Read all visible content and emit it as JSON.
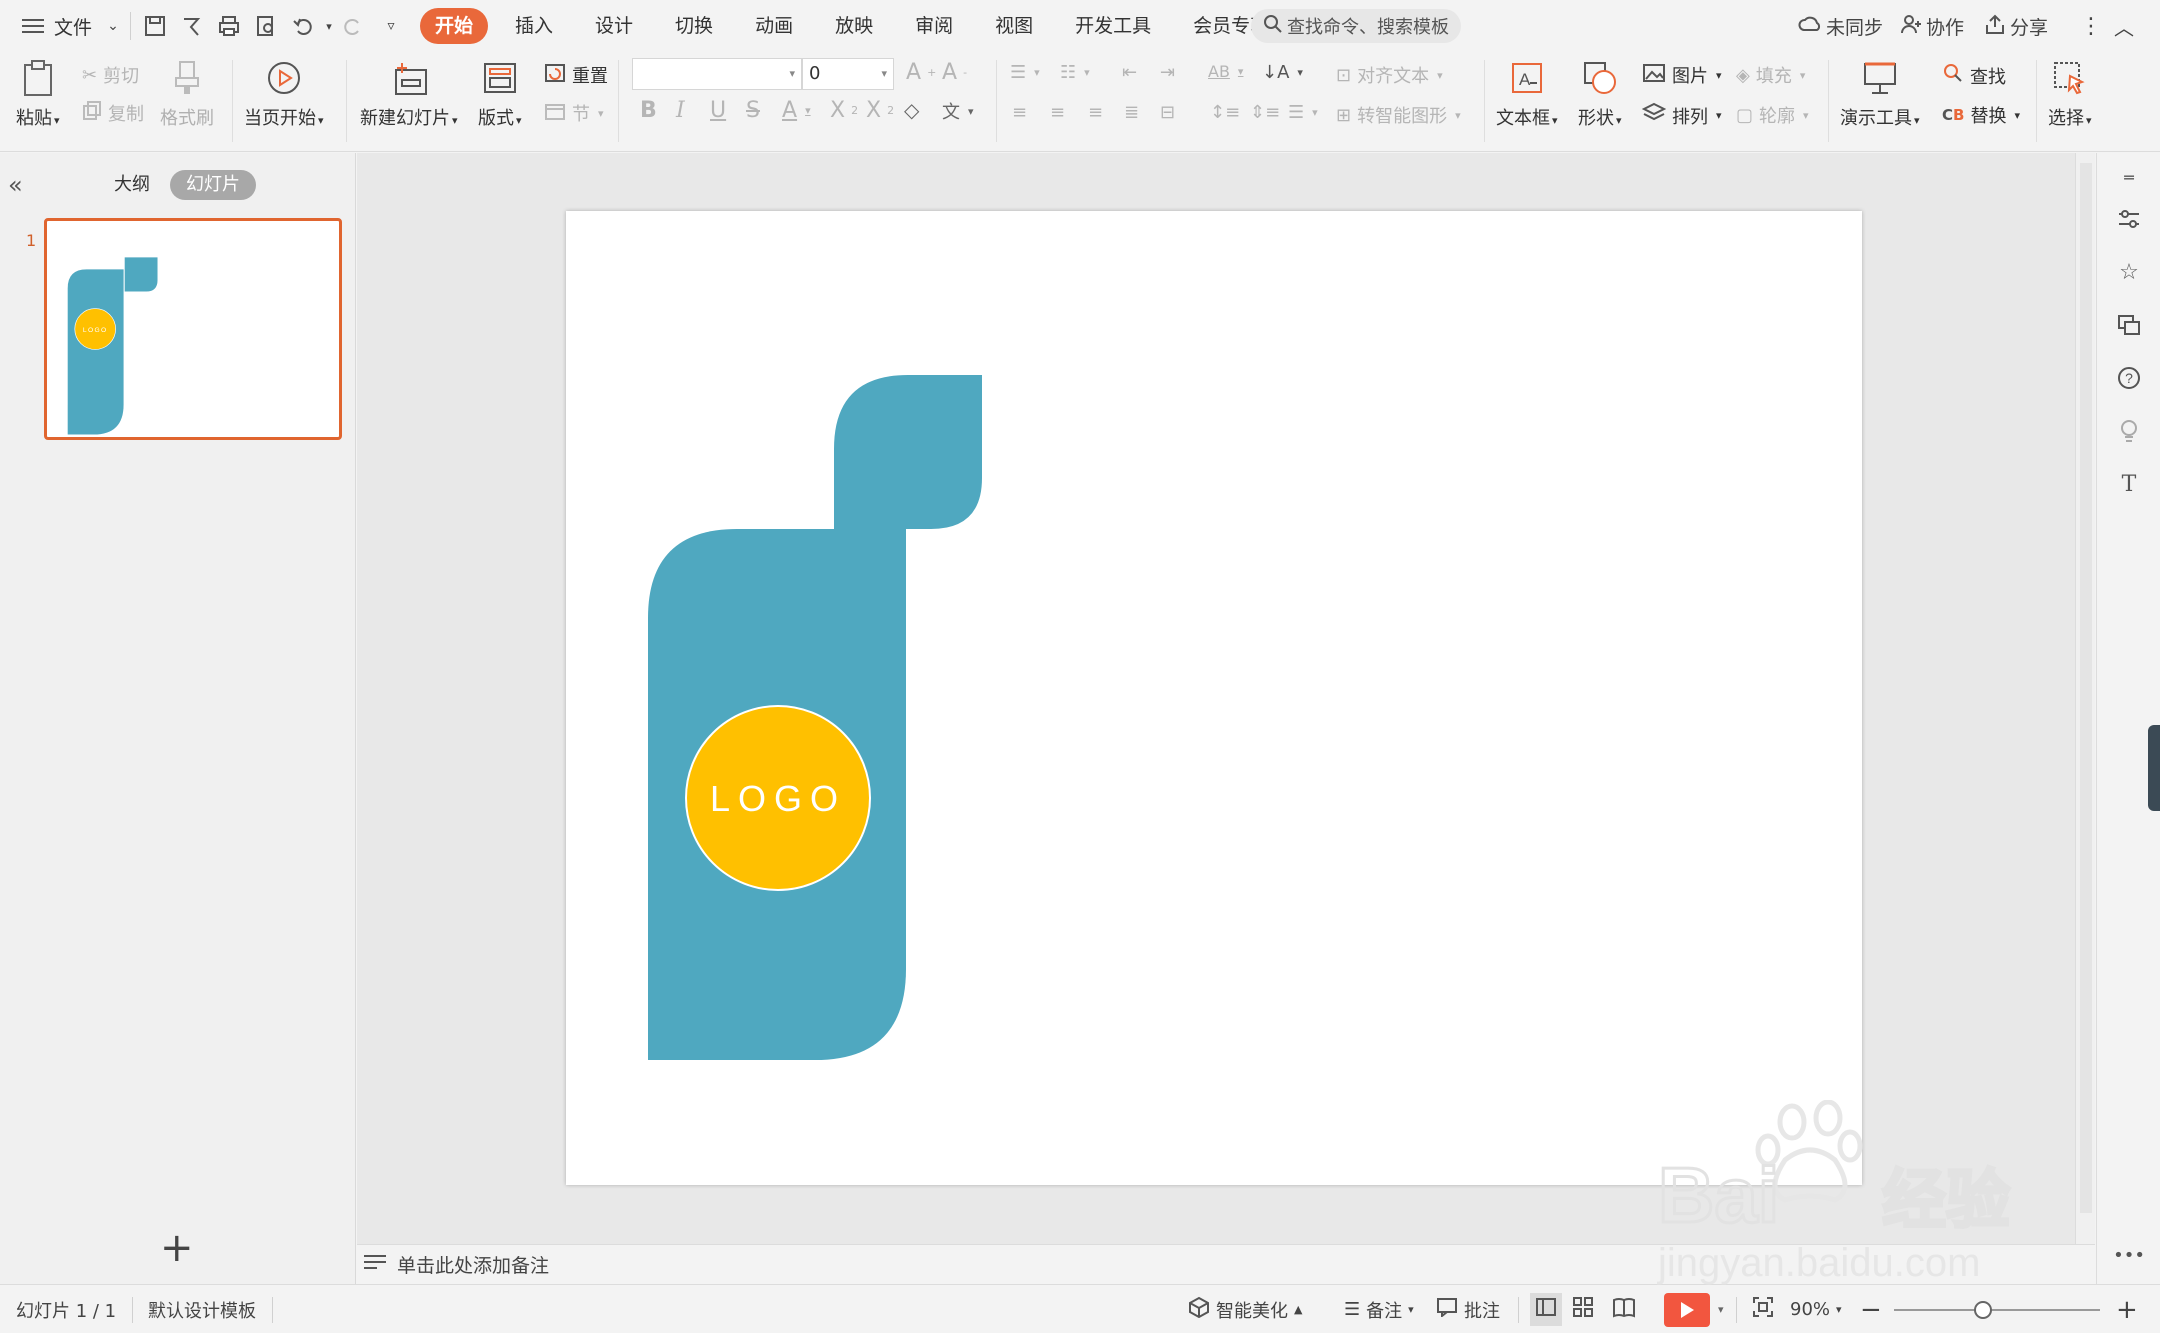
{
  "menubar": {
    "file_label": "文件",
    "tabs": [
      {
        "label": "开始",
        "active": true
      },
      {
        "label": "插入"
      },
      {
        "label": "设计"
      },
      {
        "label": "切换"
      },
      {
        "label": "动画"
      },
      {
        "label": "放映"
      },
      {
        "label": "审阅"
      },
      {
        "label": "视图"
      },
      {
        "label": "开发工具"
      },
      {
        "label": "会员专享"
      }
    ],
    "search_placeholder": "查找命令、搜索模板",
    "sync_label": "未同步",
    "collab_label": "协作",
    "share_label": "分享"
  },
  "ribbon": {
    "paste": "粘贴",
    "cut": "剪切",
    "copy": "复制",
    "format_painter": "格式刷",
    "from_current": "当页开始",
    "new_slide": "新建幻灯片",
    "layout": "版式",
    "reset": "重置",
    "section": "节",
    "font_name": "",
    "font_size": "0",
    "align_text": "对齐文本",
    "smart_shape": "转智能图形",
    "textbox": "文本框",
    "shape": "形状",
    "picture": "图片",
    "arrange": "排列",
    "fill": "填充",
    "outline": "轮廓",
    "presenter_tools": "演示工具",
    "find": "查找",
    "replace": "替换",
    "select": "选择"
  },
  "left_panel": {
    "tab_outline": "大纲",
    "tab_slides": "幻灯片",
    "slide_number": "1"
  },
  "slide": {
    "logo_text": "LOGO",
    "teal_color": "#4fa8c0",
    "logo_color": "#ffc000"
  },
  "notes": {
    "placeholder": "单击此处添加备注"
  },
  "statusbar": {
    "slide_info": "幻灯片 1 / 1",
    "template": "默认设计模板",
    "smart_beautify": "智能美化",
    "notes": "备注",
    "comments": "批注",
    "zoom": "90%"
  },
  "watermark": {
    "brand": "Bai",
    "brand_cn": "经验",
    "url": "jingyan.baidu.com"
  }
}
